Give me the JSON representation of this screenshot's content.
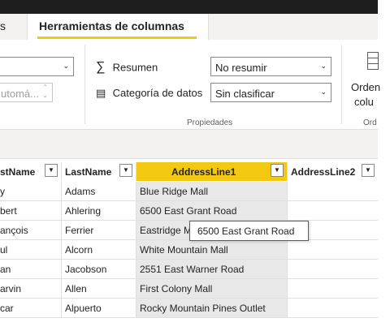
{
  "ribbon_tabs": {
    "previous_tab_fragment": "s",
    "active_tab": "Herramientas de columnas"
  },
  "ribbon": {
    "format_select_value": "",
    "type_select_value": "utomá...",
    "summary_label": "Resumen",
    "summary_value": "No resumir",
    "category_label": "Categoría de datos",
    "category_value": "Sin clasificar",
    "properties_group_label": "Propiedades",
    "order_button_line1": "Orden",
    "order_button_line2": "colu",
    "order_group_label": "Ord"
  },
  "table": {
    "columns": [
      {
        "label": "stName"
      },
      {
        "label": "LastName"
      },
      {
        "label": "AddressLine1"
      },
      {
        "label": "AddressLine2"
      }
    ],
    "rows": [
      [
        "y",
        "Adams",
        "Blue Ridge Mall",
        ""
      ],
      [
        "bert",
        "Ahlering",
        "6500 East Grant Road",
        ""
      ],
      [
        "ançois",
        "Ferrier",
        "Eastridge M",
        ""
      ],
      [
        "ul",
        "Alcorn",
        "White Mountain Mall",
        ""
      ],
      [
        "an",
        "Jacobson",
        "2551 East Warner Road",
        ""
      ],
      [
        "arvin",
        "Allen",
        "First Colony Mall",
        ""
      ],
      [
        "car",
        "Alpuerto",
        "Rocky Mountain Pines Outlet",
        ""
      ]
    ]
  },
  "tooltip_text": "6500 East Grant Road",
  "colors": {
    "accent": "#f2c811",
    "selected_column": "#e8e8e8",
    "ribbon_bg": "#f3f2f1",
    "titlebar": "#1e1e1e"
  }
}
